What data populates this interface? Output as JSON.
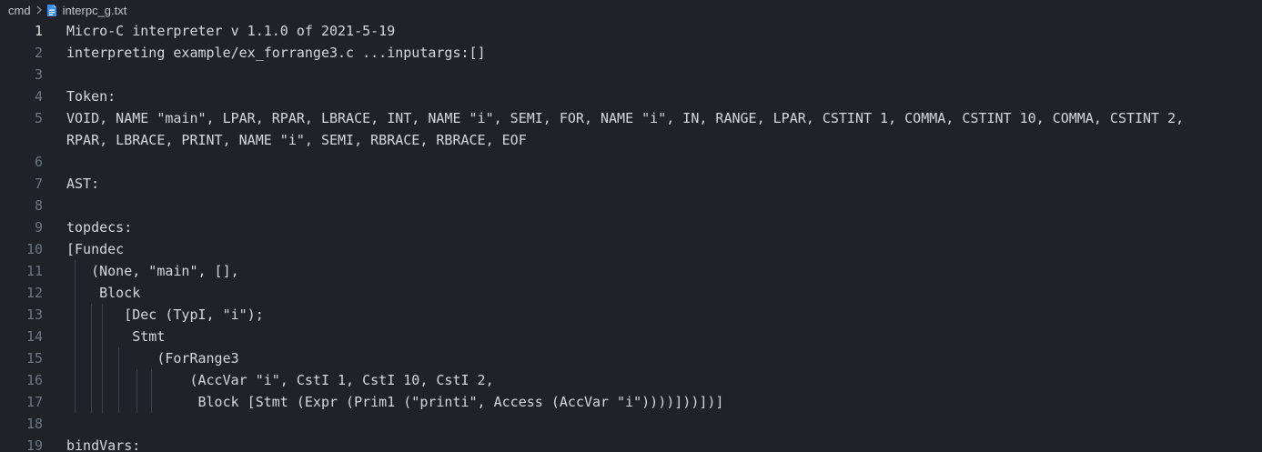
{
  "breadcrumb": {
    "folder": "cmd",
    "file": "interpc_g.txt"
  },
  "editor": {
    "current_line": 1,
    "lines": [
      {
        "num": "1",
        "text": "Micro-C interpreter v 1.1.0 of 2021-5-19"
      },
      {
        "num": "2",
        "text": "interpreting example/ex_forrange3.c ...inputargs:[]"
      },
      {
        "num": "3",
        "text": ""
      },
      {
        "num": "4",
        "text": "Token:"
      },
      {
        "num": "5",
        "text": "VOID, NAME \"main\", LPAR, RPAR, LBRACE, INT, NAME \"i\", SEMI, FOR, NAME \"i\", IN, RANGE, LPAR, CSTINT 1, COMMA, CSTINT 10, COMMA, CSTINT 2,"
      },
      {
        "num": "",
        "text": "RPAR, LBRACE, PRINT, NAME \"i\", SEMI, RBRACE, RBRACE, EOF"
      },
      {
        "num": "6",
        "text": ""
      },
      {
        "num": "7",
        "text": "AST:"
      },
      {
        "num": "8",
        "text": ""
      },
      {
        "num": "9",
        "text": "topdecs:"
      },
      {
        "num": "10",
        "text": "[Fundec"
      },
      {
        "num": "11",
        "text": "   (None, \"main\", [],"
      },
      {
        "num": "12",
        "text": "    Block"
      },
      {
        "num": "13",
        "text": "       [Dec (TypI, \"i\");"
      },
      {
        "num": "14",
        "text": "        Stmt"
      },
      {
        "num": "15",
        "text": "           (ForRange3"
      },
      {
        "num": "16",
        "text": "               (AccVar \"i\", CstI 1, CstI 10, CstI 2,"
      },
      {
        "num": "17",
        "text": "                Block [Stmt (Expr (Prim1 (\"printi\", Access (AccVar \"i\"))))]))])]"
      },
      {
        "num": "18",
        "text": ""
      },
      {
        "num": "19",
        "text": "bindVars:"
      }
    ]
  }
}
